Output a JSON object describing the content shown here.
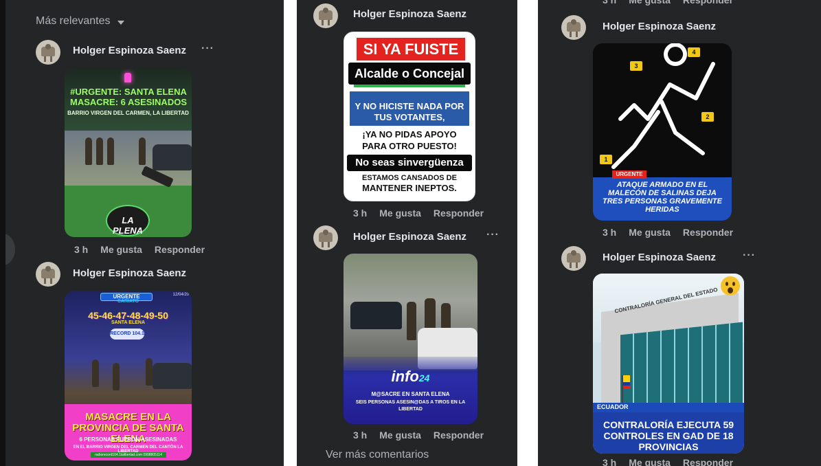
{
  "panel1": {
    "sort_label": "Más relevantes",
    "comments": [
      {
        "author": "Holger Espinoza Saenz",
        "more": "···",
        "image": {
          "headline": "#URGENTE: SANTA ELENA MASACRE: 6 ASESINADOS",
          "subline": "BARRIO VIRGEN DEL CARMEN, LA LIBERTAD",
          "logo": "LA PLENA"
        },
        "time": "3 h",
        "like": "Me gusta",
        "reply": "Responder"
      },
      {
        "author": "Holger Espinoza Saenz",
        "image": {
          "badge": "URGENTE",
          "date": "12/04/20",
          "small1": "CARIATO",
          "numbers": "45-46-47-48-49-50",
          "small2": "SANTA ELENA",
          "radio": "RECORD 104.1",
          "headline": "MASACRE EN LA PROVINCIA DE SANTA ELENA",
          "subline": "6 PERSONAS FUERON ASESINADAS",
          "detail": "EN EL BARRIO VIRGEN DEL CARMEN DEL CANTÓN LA LIBERTAD",
          "contact": "radiorecord104.1lalibertad.com  0998805114"
        }
      }
    ]
  },
  "panel2": {
    "comments": [
      {
        "author": "Holger Espinoza Saenz",
        "image": {
          "line1": "SI YA FUISTE",
          "line2": "Alcalde o Concejal",
          "line3": "Y NO HICISTE NADA POR TUS VOTANTES,",
          "line4": "¡YA NO PIDAS APOYO PARA OTRO PUESTO!",
          "line5": "No seas sinvergüenza",
          "line6": "ESTAMOS CANSADOS DE",
          "line7": "MANTENER INEPTOS."
        },
        "time": "3 h",
        "like": "Me gusta",
        "reply": "Responder"
      },
      {
        "author": "Holger Espinoza Saenz",
        "more": "···",
        "image": {
          "logo": "info",
          "logo_suffix": "24",
          "line1": "M@SACRE EN SANTA ELENA",
          "line2": "SEIS PERSONAS ASESIN@DAS A TIROS EN LA LIBERTAD"
        },
        "time": "3 h",
        "like": "Me gusta",
        "reply": "Responder"
      }
    ],
    "see_more": "Ver más comentarios"
  },
  "panel3": {
    "top_cut": {
      "time": "3 h",
      "like": "Me gusta",
      "reply": "Responder"
    },
    "comments": [
      {
        "author": "Holger Espinoza Saenz",
        "image": {
          "tag": "URGENTE",
          "headline": "ATAQUE ARMADO EN EL MALECÓN DE SALINAS DEJA TRES PERSONAS GRAVEMENTE HERIDAS",
          "markers": [
            "1",
            "2",
            "3",
            "4"
          ]
        },
        "time": "3 h",
        "like": "Me gusta",
        "reply": "Responder"
      },
      {
        "author": "Holger Espinoza Saenz",
        "more": "···",
        "image": {
          "building_sign": "CONTRALORÍA GENERAL DEL ESTADO",
          "tag": "ECUADOR",
          "headline": "CONTRALORÍA EJECUTA 59 CONTROLES EN GAD DE 18 PROVINCIAS"
        },
        "time": "3 h",
        "like": "Me gusta",
        "reply": "Responder"
      }
    ]
  },
  "colors": {
    "panel_bg": "#242526",
    "text_primary": "#e4e6eb",
    "text_secondary": "#b0b3b8"
  }
}
